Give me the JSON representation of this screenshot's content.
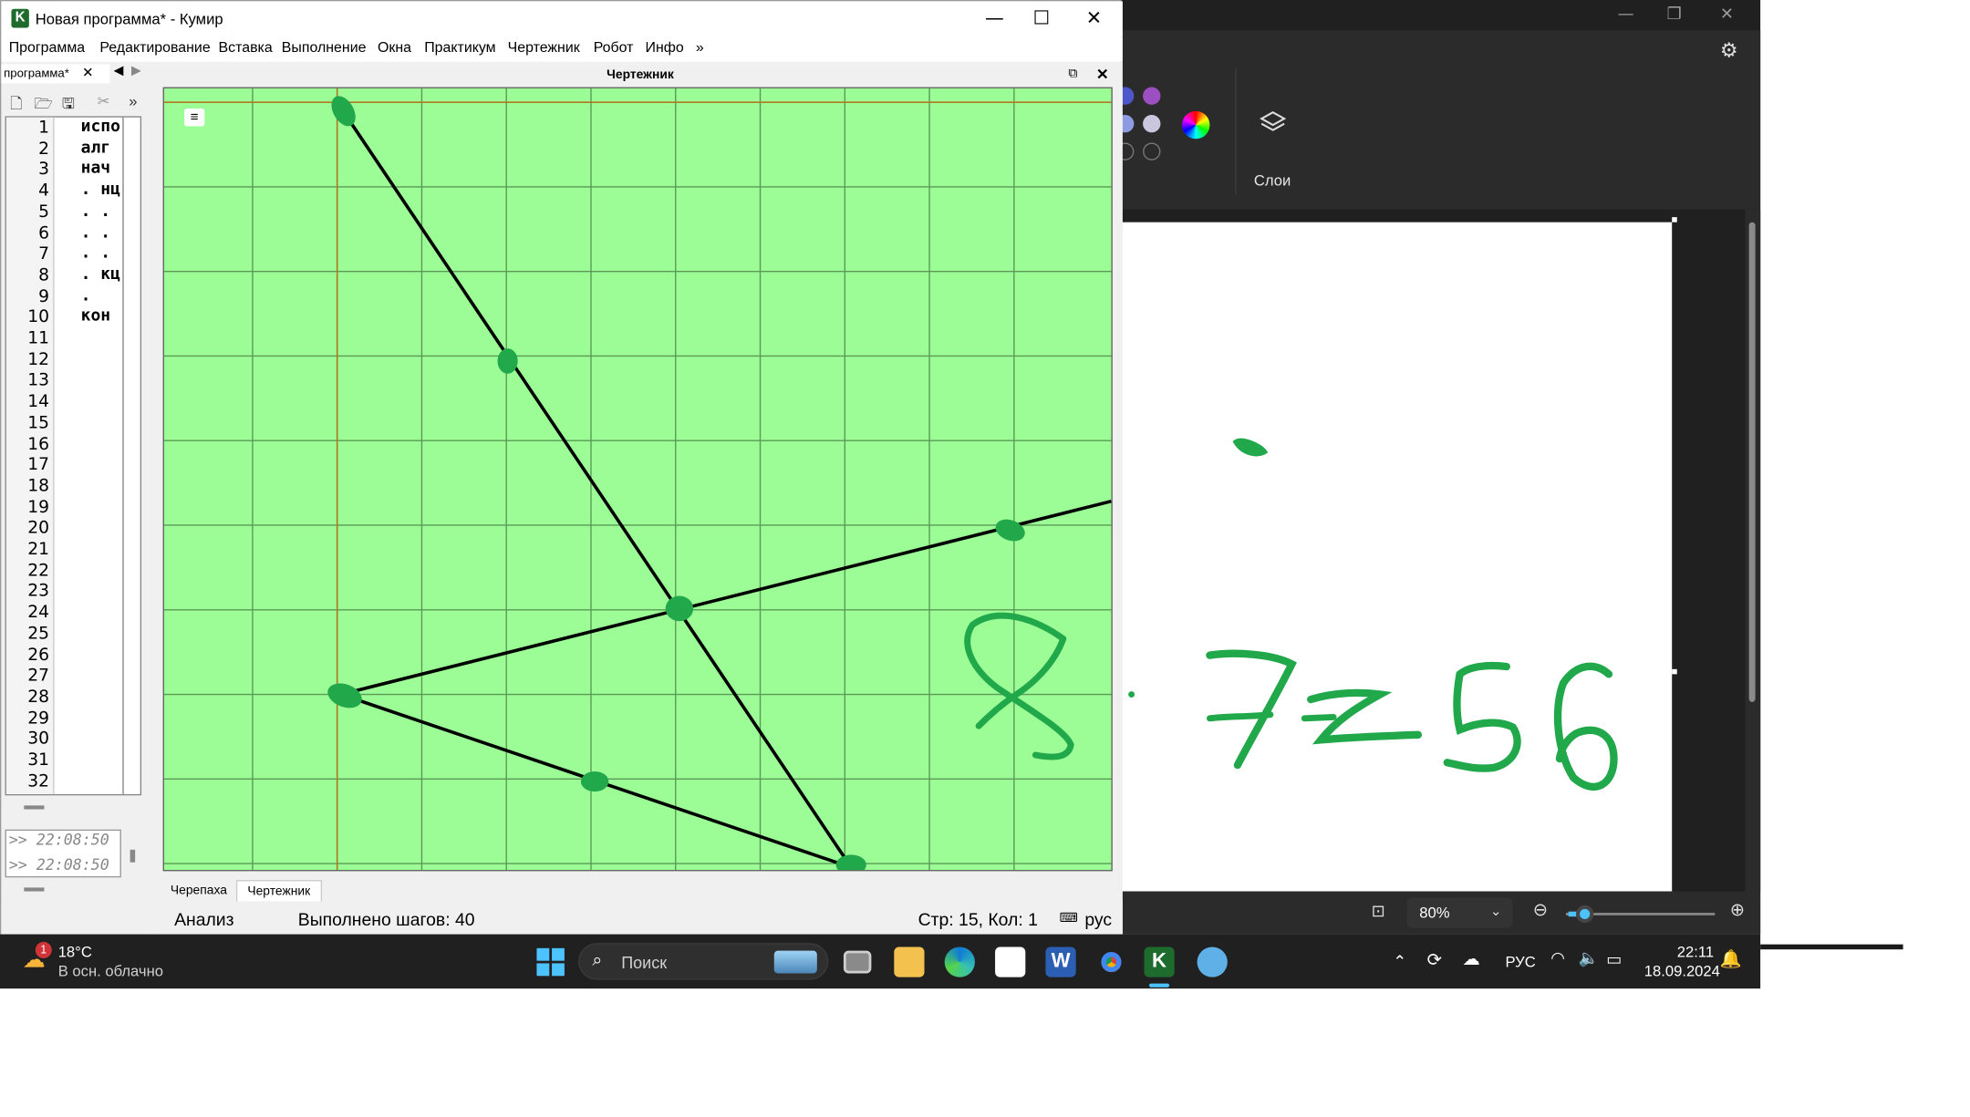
{
  "kumir": {
    "title": "Новая программа* - Кумир",
    "menu": [
      "Программа",
      "Редактирование",
      "Вставка",
      "Выполнение",
      "Окна",
      "Практикум",
      "Чертежник",
      "Робот",
      "Инфо",
      "»"
    ],
    "tab_label": "программа*",
    "line_numbers": [
      "1",
      "2",
      "3",
      "4",
      "5",
      "6",
      "7",
      "8",
      "9",
      "10",
      "11",
      "12",
      "13",
      "14",
      "15",
      "16",
      "17",
      "18",
      "19",
      "20",
      "21",
      "22",
      "23",
      "24",
      "25",
      "26",
      "27",
      "28",
      "29",
      "30",
      "31",
      "32"
    ],
    "code_lines": [
      "испо",
      "алг",
      "нач",
      ". нц",
      ". .",
      ". .",
      ". .",
      ". кц",
      ".",
      "кон"
    ],
    "console_lines": [
      ">> 22:08:50",
      ">> 22:08:50"
    ],
    "drawer_title": "Чертежник",
    "bottom_tabs": [
      "Черепаха",
      "Чертежник"
    ],
    "status": {
      "mode": "Анализ",
      "steps": "Выполнено шагов: 40",
      "position": "Стр: 15, Кол: 1",
      "lang": "рус"
    }
  },
  "paint": {
    "layers_label": "Слои",
    "zoom": "80%",
    "handwriting": "7z56",
    "colors": {
      "purple": "#9b4fc0",
      "blue": "#4d57c9",
      "lavender": "#8e9be0",
      "light": "#c9c6de",
      "stroke": "#21a84a"
    }
  },
  "plot": {
    "background": "#9cfd96",
    "grid_color": "#5a9a56",
    "axis_color": "#b07a20",
    "handwritten_digit": "8"
  },
  "taskbar": {
    "weather_temp": "18°C",
    "weather_desc": "В осн. облачно",
    "weather_badge": "1",
    "search_placeholder": "Поиск",
    "lang": "РУС",
    "time": "22:11",
    "date": "18.09.2024"
  }
}
